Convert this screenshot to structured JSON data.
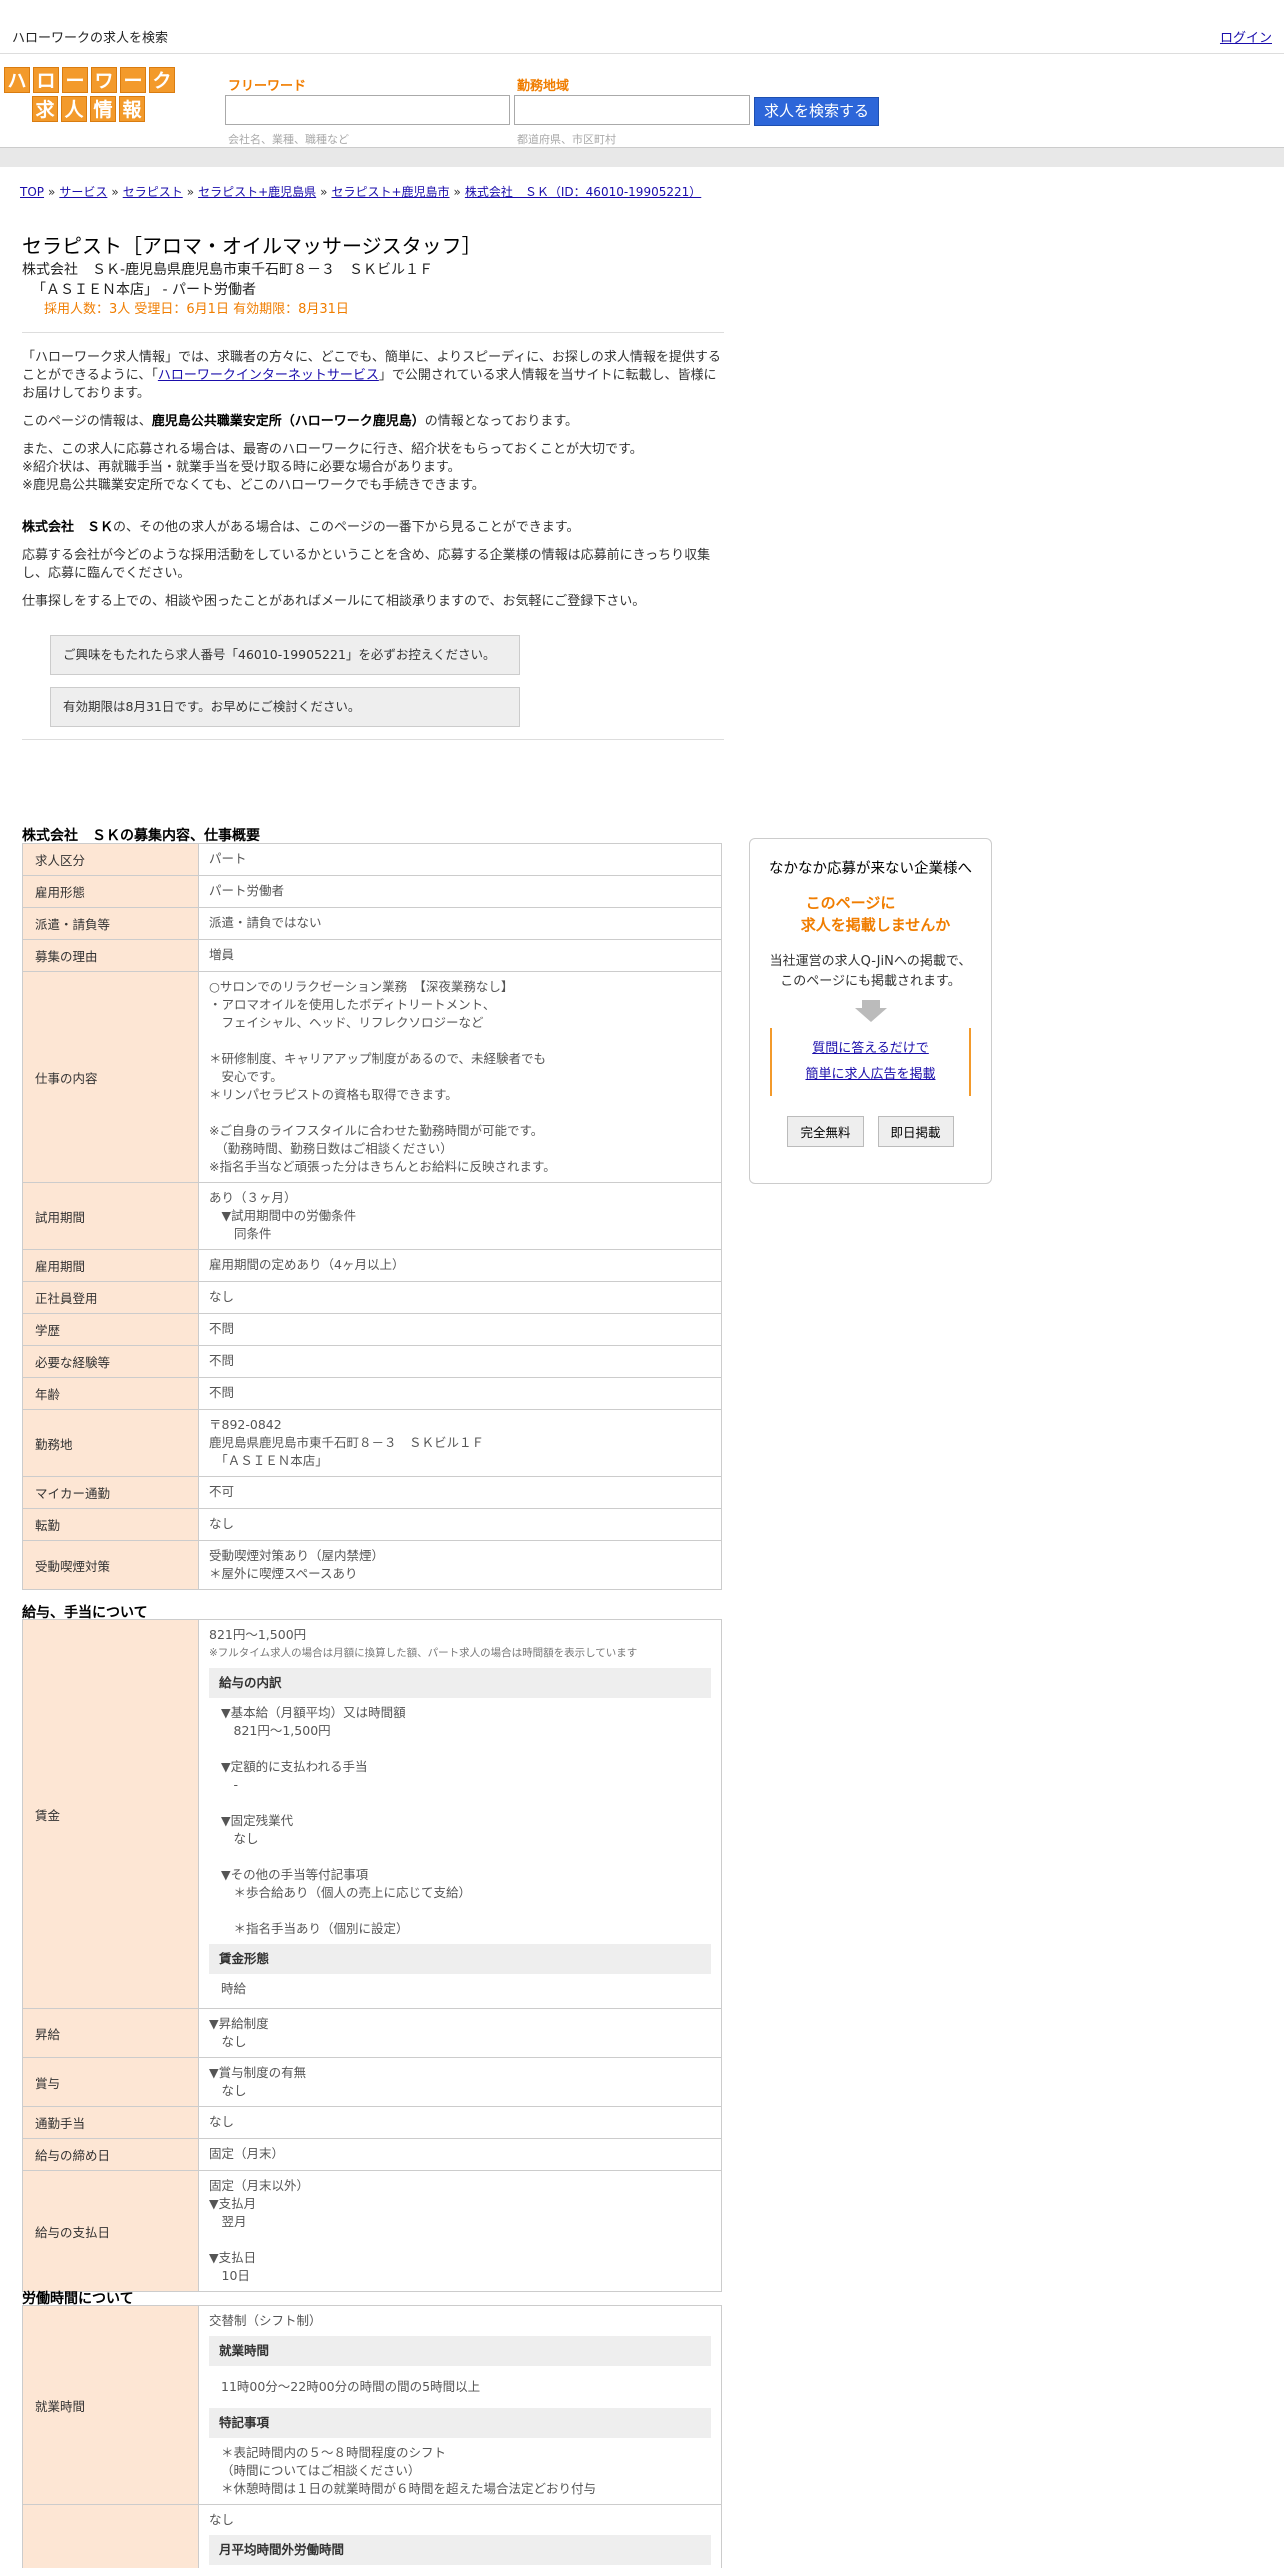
{
  "topbar": {
    "site_text": "ハローワークの求人を検索",
    "login": "ログイン"
  },
  "logo": {
    "row1": [
      "ハ",
      "ロ",
      "ー",
      "ワ",
      "ー",
      "ク"
    ],
    "row2": [
      "求",
      "人",
      "情",
      "報"
    ]
  },
  "search": {
    "freeword_label": "フリーワード",
    "freeword_hint": "会社名、業種、職種など",
    "area_label": "勤務地域",
    "area_hint": "都道府県、市区町村",
    "button": "求人を検索する"
  },
  "breadcrumb": [
    "TOP",
    "サービス",
    "セラピスト",
    "セラピスト+鹿児島県",
    "セラピスト+鹿児島市",
    "株式会社　ＳＫ（ID：46010-19905221）"
  ],
  "job": {
    "title": "セラピスト［アロマ・オイルマッサージスタッフ］",
    "company_line": "株式会社　ＳＫ-鹿児島県鹿児島市東千石町８－３　ＳＫビル１Ｆ",
    "store_line": "「ＡＳＩＥＮ本店」 - パート労働者",
    "meta": "採用人数：3人  受理日：6月1日  有効期限：8月31日"
  },
  "intro": {
    "p1_a": "「ハローワーク求人情報」では、求職者の方々に、どこでも、簡単に、よりスピーディに、お探しの求人情報を提供することができるように、「",
    "p1_link": "ハローワークインターネットサービス",
    "p1_b": "」で公開されている求人情報を当サイトに転載し、皆様にお届けしております。",
    "p2_a": "このページの情報は、",
    "p2_bold": "鹿児島公共職業安定所（ハローワーク鹿児島）",
    "p2_b": "の情報となっております。",
    "p3": "また、この求人に応募される場合は、最寄のハローワークに行き、紹介状をもらっておくことが大切です。\n※紹介状は、再就職手当・就業手当を受け取る時に必要な場合があります。\n※鹿児島公共職業安定所でなくても、どこのハローワークでも手続きできます。",
    "p4_bold": "株式会社　ＳＫ",
    "p4_b": "の、その他の求人がある場合は、このページの一番下から見ることができます。",
    "p5": "応募する会社が今どのような採用活動をしているかということを含め、応募する企業様の情報は応募前にきっちり収集し、応募に臨んでください。",
    "p6": "仕事探しをする上での、相談や困ったことがあればメールにて相談承りますので、お気軽にご登録下さい。",
    "notice1": "ご興味をもたれたら求人番号「46010-19905221」を必ずお控えください。",
    "notice2": "有効期限は8月31日です。お早めにご検討ください。"
  },
  "section1": {
    "title": "株式会社　ＳＫの募集内容、仕事概要",
    "rows": [
      {
        "k": "求人区分",
        "v": "パート"
      },
      {
        "k": "雇用形態",
        "v": "パート労働者"
      },
      {
        "k": "派遣・請負等",
        "v": "派遣・請負ではない"
      },
      {
        "k": "募集の理由",
        "v": "増員"
      },
      {
        "k": "仕事の内容",
        "v": "○サロンでのリラクゼーション業務　【深夜業務なし】\n・アロマオイルを使用したボディトリートメント、\n　フェイシャル、ヘッド、リフレクソロジーなど\n\n＊研修制度、キャリアアップ制度があるので、未経験者でも\n　安心です。\n＊リンパセラピストの資格も取得できます。\n\n※ご自身のライフスタイルに合わせた勤務時間が可能です。\n　（勤務時間、勤務日数はご相談ください）\n※指名手当など頑張った分はきちんとお給料に反映されます。"
      },
      {
        "k": "試用期間",
        "v": "あり（３ヶ月）\n　▼試用期間中の労働条件\n　　同条件"
      },
      {
        "k": "雇用期間",
        "v": "雇用期間の定めあり（4ヶ月以上）"
      },
      {
        "k": "正社員登用",
        "v": "なし"
      },
      {
        "k": "学歴",
        "v": "不問"
      },
      {
        "k": "必要な経験等",
        "v": "不問"
      },
      {
        "k": "年齢",
        "v": "不問"
      },
      {
        "k": "勤務地",
        "v": "〒892-0842\n鹿児島県鹿児島市東千石町８－３　ＳＫビル１Ｆ\n　「ＡＳＩＥＮ本店」"
      },
      {
        "k": "マイカー通勤",
        "v": "不可"
      },
      {
        "k": "転勤",
        "v": "なし"
      },
      {
        "k": "受動喫煙対策",
        "v": "受動喫煙対策あり（屋内禁煙）\n＊屋外に喫煙スペースあり"
      }
    ]
  },
  "section2": {
    "title": "給与、手当について",
    "wage_label": "賃金",
    "wage_range": "821円〜1,500円",
    "wage_note": "※フルタイム求人の場合は月額に換算した額、パート求人の場合は時間額を表示しています",
    "breakdown_head": "給与の内訳",
    "breakdown": "▼基本給（月額平均）又は時間額\n　821円〜1,500円\n\n▼定額的に支払われる手当\n　-\n\n▼固定残業代\n　なし\n\n▼その他の手当等付記事項\n　＊歩合給あり（個人の売上に応じて支給）\n\n　＊指名手当あり（個別に設定）",
    "form_head": "賃金形態",
    "form": "時給",
    "rows": [
      {
        "k": "昇給",
        "v": "▼昇給制度\n　なし"
      },
      {
        "k": "賞与",
        "v": "▼賞与制度の有無\n　なし"
      },
      {
        "k": "通勤手当",
        "v": "なし"
      },
      {
        "k": "給与の締め日",
        "v": "固定（月末）"
      },
      {
        "k": "給与の支払日",
        "v": "固定（月末以外）\n▼支払月\n　翌月\n\n▼支払日\n　10日"
      }
    ]
  },
  "section3": {
    "title": "労働時間について",
    "label": "就業時間",
    "type": "交替制（シフト制）",
    "hours_head": "就業時間",
    "hours": "11時00分〜22時00分の時間の間の5時間以上",
    "special_head": "特記事項",
    "special": "＊表記時間内の５～８時間程度のシフト\n（時間についてはご相談ください）\n＊休憩時間は１日の就業時間が６時間を超えた場合法定どおり付与",
    "row2_value": "なし",
    "row2_head": "月平均時間外労働時間"
  },
  "sidead": {
    "heading": "なかなか応募が来ない企業様へ",
    "orange1": "このページに",
    "orange2": "求人を掲載しませんか",
    "desc1": "当社運営の求人Q-JiNへの掲載で、",
    "desc2": "このページにも掲載されます。",
    "link1": "質問に答えるだけで",
    "link2": "簡単に求人広告を掲載",
    "btn1": "完全無料",
    "btn2": "即日掲載"
  },
  "colors": {
    "accent_orange": "#f07d00",
    "label_bg": "#fde6d4",
    "search_blue": "#2d66d9"
  }
}
